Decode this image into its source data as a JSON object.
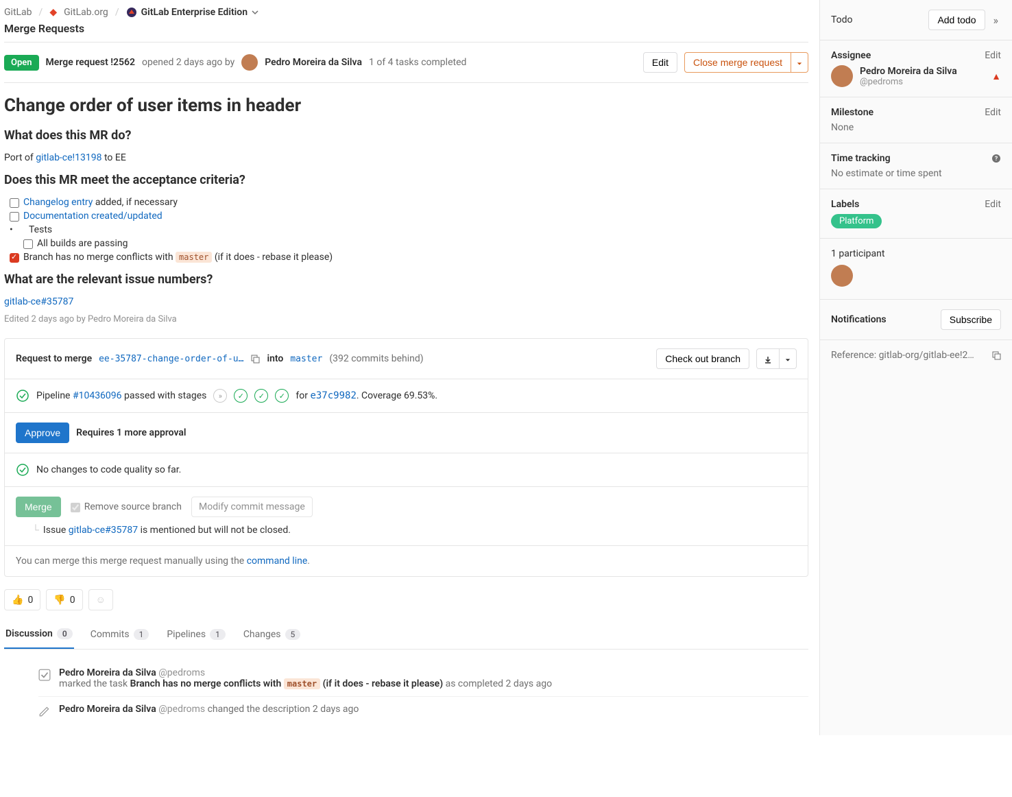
{
  "breadcrumb": {
    "root": "GitLab",
    "org": "GitLab.org",
    "project": "GitLab Enterprise Edition"
  },
  "page_subtitle": "Merge Requests",
  "header": {
    "state": "Open",
    "mr_ref": "Merge request !2562",
    "opened": "opened 2 days ago by",
    "author": "Pedro Moreira da Silva",
    "tasks": "1 of 4 tasks completed",
    "edit": "Edit",
    "close": "Close merge request"
  },
  "title": "Change order of user items in header",
  "sections": {
    "what_h": "What does this MR do?",
    "port_prefix": "Port of ",
    "port_link": "gitlab-ce!13198",
    "port_suffix": " to EE",
    "criteria_h": "Does this MR meet the acceptance criteria?",
    "changelog_link": "Changelog entry",
    "changelog_suffix": " added, if necessary",
    "doc_link": "Documentation created/updated",
    "tests": "Tests",
    "all_builds": "All builds are passing",
    "branch_prefix": "Branch has no merge conflicts with ",
    "branch_code": "master",
    "branch_suffix": " (if it does - rebase it please)",
    "issues_h": "What are the relevant issue numbers?",
    "issue_link": "gitlab-ce#35787",
    "edited": "Edited 2 days ago by Pedro Moreira da Silva"
  },
  "widget": {
    "req_label": "Request to merge",
    "source": "ee-35787-change-order-of-u…",
    "into": "into",
    "target": "master",
    "behind": "(392 commits behind)",
    "checkout": "Check out branch",
    "pipeline_word": "Pipeline ",
    "pipeline_id": "#10436096",
    "pipeline_mid": " passed with stages",
    "for": "for ",
    "sha": "e37c9982",
    "coverage": ". Coverage 69.53%.",
    "approve": "Approve",
    "approve_hint": "Requires 1 more approval",
    "quality": "No changes to code quality so far.",
    "merge": "Merge",
    "remove": "Remove source branch",
    "modify": "Modify commit message",
    "issue_prefix": "Issue ",
    "issue_ref": "gitlab-ce#35787",
    "issue_suffix": " is mentioned but will not be closed.",
    "manual_prefix": "You can merge this merge request manually using the ",
    "manual_link": "command line"
  },
  "reactions": {
    "thumbs_up": "0",
    "thumbs_down": "0"
  },
  "tabs": {
    "discussion": "Discussion",
    "discussion_n": "0",
    "commits": "Commits",
    "commits_n": "1",
    "pipelines": "Pipelines",
    "pipelines_n": "1",
    "changes": "Changes",
    "changes_n": "5"
  },
  "notes": {
    "n1_who": "Pedro Moreira da Silva",
    "n1_handle": "@pedroms",
    "n1_prefix": "marked the task ",
    "n1_task_a": "Branch has no merge conflicts with ",
    "n1_task_code": "master",
    "n1_task_b": " (if it does - rebase it please)",
    "n1_suffix": " as completed 2 days ago",
    "n2_who": "Pedro Moreira da Silva",
    "n2_handle": "@pedroms",
    "n2_text": " changed the description 2 days ago"
  },
  "sidebar": {
    "todo": "Todo",
    "add_todo": "Add todo",
    "assignee": "Assignee",
    "edit": "Edit",
    "assignee_name": "Pedro Moreira da Silva",
    "assignee_handle": "@pedroms",
    "milestone": "Milestone",
    "milestone_val": "None",
    "tracking": "Time tracking",
    "tracking_val": "No estimate or time spent",
    "labels": "Labels",
    "label_val": "Platform",
    "participants": "1 participant",
    "notifications": "Notifications",
    "subscribe": "Subscribe",
    "reference": "Reference: gitlab-org/gitlab-ee!2…"
  }
}
